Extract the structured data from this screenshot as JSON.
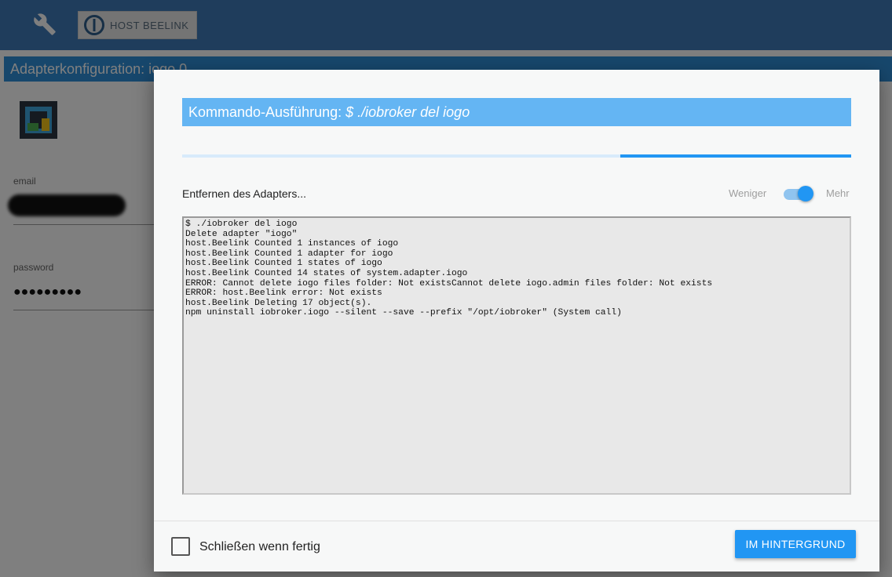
{
  "topbar": {
    "icons": {
      "settings": "wrench-icon",
      "host": "iobroker-logo-icon"
    },
    "host_label": "HOST BEELINK"
  },
  "page": {
    "title": "Adapterkonfiguration: iogo.0",
    "fields": [
      {
        "label": "email",
        "value": ""
      },
      {
        "label": "password",
        "value": "●●●●●●●●●"
      }
    ]
  },
  "dialog": {
    "title_prefix": "Kommando-Ausführung: ",
    "title_command": "$ ./iobroker del iogo",
    "progress_fraction": 0.655,
    "status": "Entfernen des Adapters...",
    "toggle_less": "Weniger",
    "toggle_more": "Mehr",
    "toggle_on": true,
    "console_lines": [
      "$ ./iobroker del iogo",
      "Delete adapter \"iogo\"",
      "host.Beelink Counted 1 instances of iogo",
      "host.Beelink Counted 1 adapter for iogo",
      "host.Beelink Counted 1 states of iogo",
      "host.Beelink Counted 14 states of system.adapter.iogo",
      "ERROR: Cannot delete iogo files folder: Not existsCannot delete iogo.admin files folder: Not exists",
      "ERROR: host.Beelink error: Not exists",
      "host.Beelink Deleting 17 object(s).",
      "npm uninstall iobroker.iogo --silent --save --prefix \"/opt/iobroker\" (System call)"
    ],
    "close_when_done_label": "Schließen wenn fertig",
    "close_when_done_checked": false,
    "background_button": "IM HINTERGRUND"
  },
  "colors": {
    "topbar": "#3f7ab8",
    "accent": "#2196f3",
    "title_bar": "#64b5f3"
  }
}
